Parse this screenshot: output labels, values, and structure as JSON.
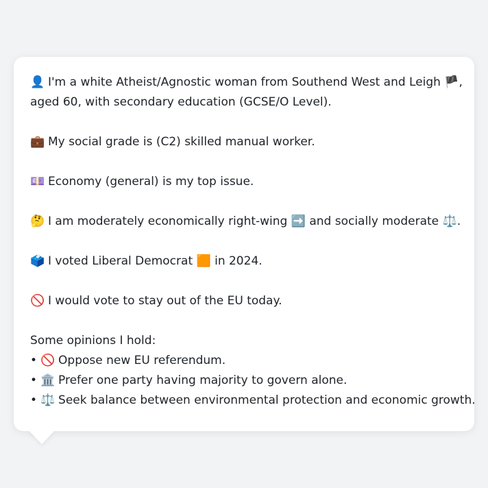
{
  "profile": {
    "identity": {
      "icon": "👤",
      "text_before": "I'm a white Atheist/Agnostic woman from Southend West and Leigh",
      "flag": "🏴",
      "text_after": ",",
      "line2": "aged 60, with secondary education (GCSE/O Level)."
    },
    "social_grade": {
      "icon": "💼",
      "text": "My social grade is (C2) skilled manual worker."
    },
    "top_issue": {
      "icon": "💷",
      "text": "Economy (general) is my top issue."
    },
    "ideology": {
      "icon": "🤔",
      "text_before": "I am moderately economically right-wing",
      "arrow": "➡️",
      "text_middle": "and socially moderate",
      "scale": "⚖️",
      "text_after": "."
    },
    "vote_2024": {
      "icon": "🗳️",
      "text_before": "I voted Liberal Democrat",
      "party_square": "🟧",
      "text_after": "in 2024."
    },
    "eu_vote": {
      "icon": "🚫",
      "text": "I would vote to stay out of the EU today."
    },
    "opinions": {
      "heading": "Some opinions I hold:",
      "items": [
        {
          "bullet": "•",
          "icon": "🚫",
          "text": "Oppose new EU referendum."
        },
        {
          "bullet": "•",
          "icon": "🏛️",
          "text": "Prefer one party having majority to govern alone."
        },
        {
          "bullet": "•",
          "icon": "⚖️",
          "text": "Seek balance between environmental protection and economic growth."
        }
      ]
    }
  }
}
